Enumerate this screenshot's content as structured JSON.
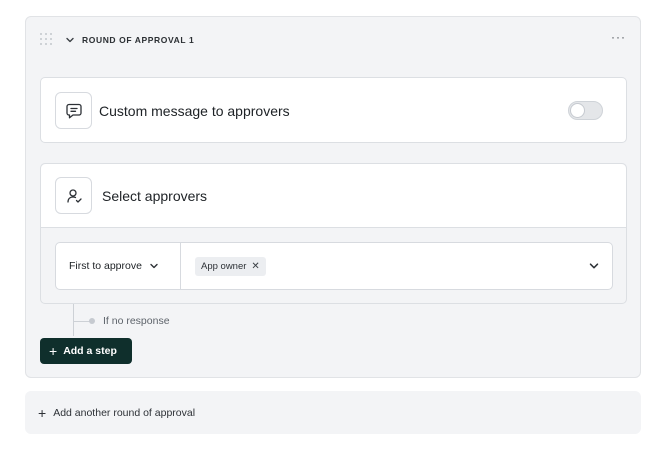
{
  "round": {
    "title": "ROUND OF APPROVAL 1",
    "menu_glyph": "···"
  },
  "custom_message": {
    "title": "Custom message to approvers",
    "icon": "message-square-icon",
    "toggle_on": false
  },
  "approvers": {
    "title": "Select approvers",
    "icon": "user-check-icon",
    "mode": "First to approve",
    "chips": [
      {
        "label": "App owner",
        "remove_glyph": "✕"
      }
    ]
  },
  "escalation": {
    "label": "If no response"
  },
  "add_step": {
    "plus": "+",
    "label": "Add a step"
  },
  "add_round": {
    "plus": "+",
    "label": "Add another round of approval"
  },
  "colors": {
    "primary_button": "#0f2f2c",
    "card_bg": "#f3f4f6",
    "border": "#dcdfe3"
  }
}
